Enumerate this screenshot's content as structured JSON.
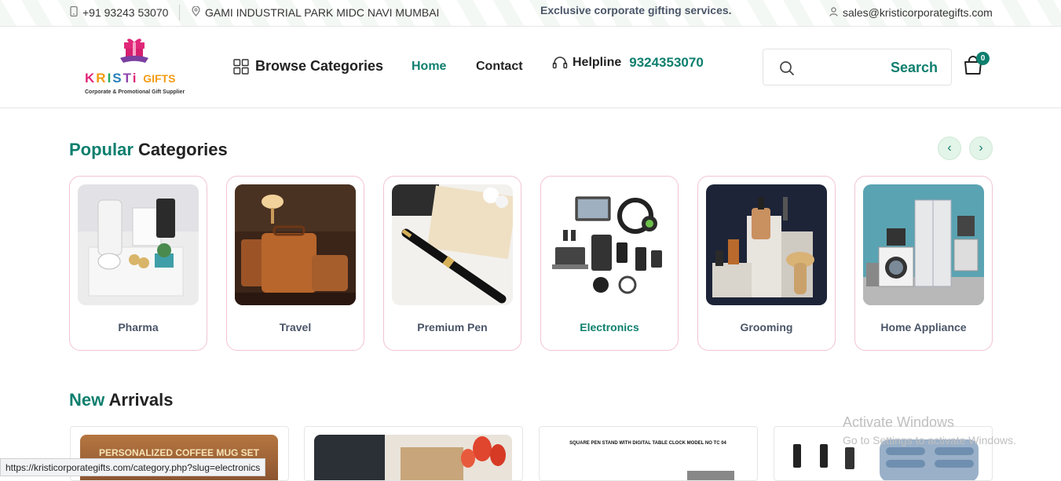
{
  "topbar": {
    "phone": "+91 93243 53070",
    "address": "GAMI INDUSTRIAL PARK MIDC NAVI MUMBAI",
    "promo": "Exclusive corporate gifting services.",
    "email": "sales@kristicorporategifts.com"
  },
  "logo": {
    "wordmark": "KRISTi GIFTS",
    "tagline": "Corporate & Promotional Gift Supplier"
  },
  "nav": {
    "browse": "Browse Categories",
    "home": "Home",
    "contact": "Contact",
    "helpline_label": "Helpline",
    "helpline_number": "9324353070"
  },
  "search": {
    "button": "Search",
    "placeholder": ""
  },
  "cart": {
    "count": "0"
  },
  "popular": {
    "title_accent": "Popular",
    "title_rest": "Categories",
    "categories": [
      {
        "name": "Pharma"
      },
      {
        "name": "Travel"
      },
      {
        "name": "Premium Pen"
      },
      {
        "name": "Electronics"
      },
      {
        "name": "Grooming"
      },
      {
        "name": "Home Appliance"
      }
    ]
  },
  "arrivals": {
    "title_accent": "New",
    "title_rest": "Arrivals",
    "products": [
      {
        "banner": "PERSONALIZED COFFEE MUG SET"
      },
      {
        "banner": ""
      },
      {
        "banner": "SQUARE PEN STAND WITH DIGITAL TABLE CLOCK  MODEL NO TC 04"
      },
      {
        "banner": ""
      }
    ]
  },
  "watermark": {
    "line1": "Activate Windows",
    "line2": "Go to Settings to activate Windows."
  },
  "status_url": "https://kristicorporategifts.com/category.php?slug=electronics",
  "colors": {
    "accent": "#0e7f6e",
    "card_border": "#f2c4d4",
    "arrow_bg": "#e3f4e8"
  }
}
